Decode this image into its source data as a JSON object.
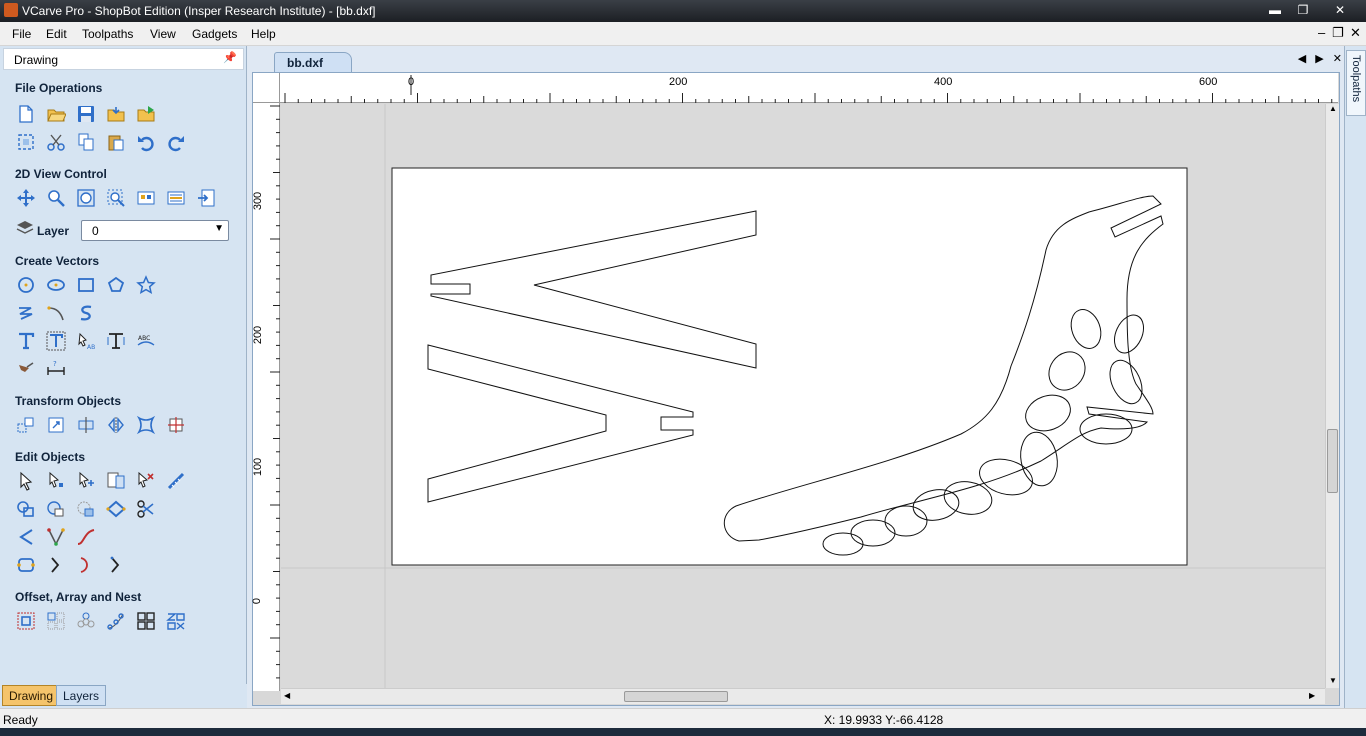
{
  "window": {
    "title": "VCarve Pro - ShopBot Edition (Insper Research Institute) - [bb.dxf]",
    "min_glyph": "▬",
    "max_glyph": "❐",
    "close_glyph": "✕"
  },
  "menubar": {
    "items": [
      "File",
      "Edit",
      "Toolpaths",
      "View",
      "Gadgets",
      "Help"
    ],
    "mdi_min": "–",
    "mdi_restore": "❐",
    "mdi_close": "✕"
  },
  "panel": {
    "title": "Drawing",
    "pin_glyph": "📌",
    "sections": {
      "file_operations": "File Operations",
      "view_control": "2D View Control",
      "create_vectors": "Create Vectors",
      "transform_objects": "Transform Objects",
      "edit_objects": "Edit Objects",
      "offset_array_nest": "Offset, Array and Nest"
    },
    "layer": {
      "label": "Layer",
      "value": "0",
      "arrow": "▼"
    },
    "bottom_tabs": [
      "Drawing",
      "Layers"
    ]
  },
  "document": {
    "tab": "bb.dxf",
    "nav": [
      "◀",
      "▶",
      "✕"
    ],
    "hruler_labels": [
      "0",
      "200",
      "400",
      "600"
    ],
    "vruler_labels": [
      "300",
      "200",
      "100",
      "0"
    ]
  },
  "right_strip": {
    "tab": "Toolpaths"
  },
  "status": {
    "text": "Ready",
    "coords": "X: 19.9933 Y:-66.4128"
  },
  "colors": {
    "panel_bg": "#d6e4f2",
    "accent_tab": "#f5c46b",
    "icon_blue": "#2f6fc9"
  }
}
